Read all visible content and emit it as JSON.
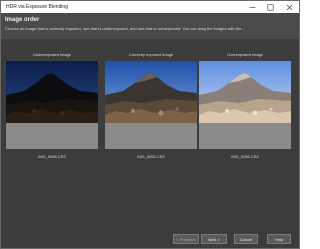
{
  "window": {
    "title": "HDR via Exposure Blending"
  },
  "header": {
    "heading": "Image order",
    "description": "Choose an image that is correctly exposed, one that is underexposed, and one that is overexposed. You can drag the images with the..."
  },
  "panels": [
    {
      "caption": "Underexposed image",
      "filename": "IMG_5055.CR2"
    },
    {
      "caption": "Correctly exposed image",
      "filename": "IMG_5052.CR2"
    },
    {
      "caption": "Overexposed image",
      "filename": "IMG_5056.CR2"
    }
  ],
  "footer": {
    "previous_label": "< Previous",
    "next_label": "Next >",
    "cancel_label": "Cancel",
    "help_label": "Help"
  },
  "colors": {
    "background": "#3c3c3c",
    "header": "#4a4a4a",
    "frame": "#8a8a8a"
  }
}
